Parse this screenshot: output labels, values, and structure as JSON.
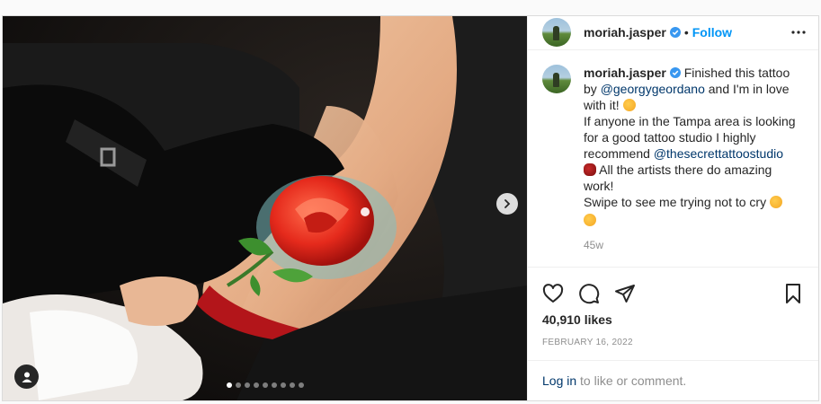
{
  "post": {
    "username": "moriah.jasper",
    "follow_label": "Follow",
    "separator": "•",
    "caption": {
      "username": "moriah.jasper",
      "text_1": " Finished this tattoo by ",
      "mention_1": "@georgygeordano",
      "text_2": " and I'm in love with it! ",
      "line_2_a": "If anyone in the Tampa area is looking for a good tattoo studio I highly recommend ",
      "mention_2": "@thesecrettattoostudio",
      "line_2_b": " All the artists there do amazing work!",
      "line_3": "Swipe to see me trying not to cry ",
      "time_ago": "45w"
    },
    "likes": "40,910 likes",
    "date": "FEBRUARY 16, 2022",
    "login_link": "Log in",
    "login_rest": " to like or comment."
  },
  "carousel": {
    "count": 9,
    "active_index": 0
  },
  "icons": {
    "verified": "verified-badge-icon",
    "more": "more-options-icon",
    "like": "heart-icon",
    "comment": "comment-icon",
    "share": "share-icon",
    "save": "bookmark-icon",
    "next": "chevron-right-icon",
    "user_tag": "user-tag-icon"
  },
  "colors": {
    "accent": "#0095f6",
    "mention": "#00376b",
    "muted": "#8e8e8e",
    "verified": "#3897f0"
  }
}
